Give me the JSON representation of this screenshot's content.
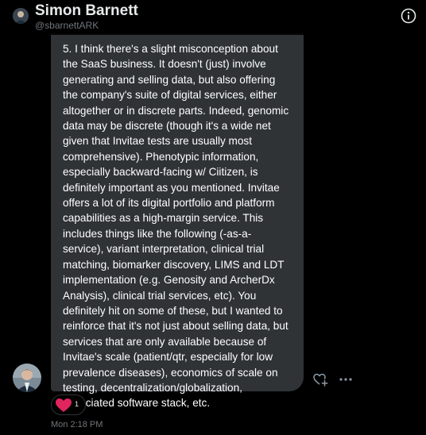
{
  "conversation_header": {
    "name": "Simon Barnett",
    "handle": "@sbarnettARK",
    "info_icon": "info-circle-icon"
  },
  "message": {
    "text": "5. I think there's a slight misconception about the SaaS business. It doesn't (just) involve generating and selling data, but also offering the company's suite of digital services, either altogether or in discrete parts. Indeed, genomic data may be discrete (though it's a wide net given that Invitae tests are usually most comprehensive). Phenotypic information, especially backward-facing w/ Ciitizen, is definitely important as you mentioned. Invitae offers a lot of its digital portfolio and platform capabilities as a high-margin service. This includes things like the following (-as-a-service), variant interpretation, clinical trial matching, biomarker discovery, LIMS and LDT implementation (e.g. Genosity and ArcherDx Analysis), clinical trial services, etc). You definitely hit on some of these, but I wanted to reinforce that it's not just about selling data, but services that are only available because of Invitae's scale (patient/qtr, especially for low prevalence diseases), economics of scale on testing, decentralization/globalization, associated software stack, etc.",
    "bubble_color": "#2f3336",
    "actions": {
      "react_icon": "heart-plus-icon",
      "more_icon": "more-horizontal-icon"
    },
    "reaction": {
      "emoji_icon": "red-heart-icon",
      "count": "1",
      "color": "#e0245e"
    },
    "timestamp": "Mon 2:18 PM"
  },
  "colors": {
    "background": "#000000",
    "secondary_text": "#71767b"
  }
}
